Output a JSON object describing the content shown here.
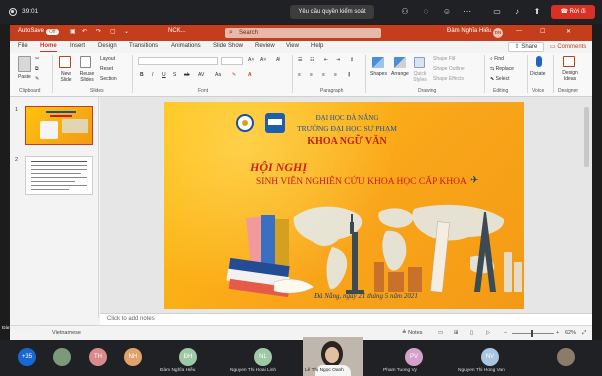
{
  "meeting": {
    "timer": "39:01",
    "request_control_label": "Yêu cầu quyền kiểm soát",
    "leave_label": "Rời đi",
    "presenter_tag": "Đàm Nghĩa Hiếu"
  },
  "ppt": {
    "autosave_label": "AutoSave",
    "autosave_state": "Off",
    "file_name": "NCK...",
    "search_placeholder": "Search",
    "user_name": "Đàm Nghĩa Hiếu",
    "user_initials": "DN",
    "tabs": [
      "File",
      "Home",
      "Insert",
      "Design",
      "Transitions",
      "Animations",
      "Slide Show",
      "Review",
      "View",
      "Help"
    ],
    "active_tab": "Home",
    "share_label": "Share",
    "comments_label": "Comments",
    "ribbon": {
      "groups": [
        "Clipboard",
        "Slides",
        "Font",
        "Paragraph",
        "Drawing",
        "Editing",
        "Voice",
        "Designer"
      ],
      "new_slide": "New Slide",
      "reuse_slides": "Reuse Slides",
      "layout": "Layout",
      "reset": "Reset",
      "section": "Section",
      "shapes": "Shapes",
      "arrange": "Arrange",
      "quick_styles": "Quick Styles",
      "shape_fill": "Shape Fill",
      "shape_outline": "Shape Outline",
      "shape_effects": "Shape Effects",
      "find": "Find",
      "replace": "Replace",
      "select": "Select",
      "dictate": "Dictate",
      "design_ideas": "Design Ideas"
    },
    "slide_numbers": [
      "1",
      "2"
    ],
    "notes_placeholder": "Click to add notes",
    "status": {
      "left": "Vietnamese",
      "notes_label": "Notes",
      "zoom": "62%"
    }
  },
  "slide": {
    "university": "ĐẠI HỌC ĐÀ NẴNG",
    "school": "TRƯỜNG ĐẠI HỌC SƯ PHẠM",
    "faculty": "KHOA NGỮ VĂN",
    "conference": "HỘI NGHỊ",
    "event": "SINH VIÊN NGHIÊN CỨU KHOA HỌC CẤP KHOA",
    "date_line": "Đà Nẵng, ngày 21 tháng 5 năm 2021"
  },
  "participants": {
    "overflow_count": "+35",
    "people": [
      {
        "initials": "TH",
        "name": "",
        "color": "#d98b8b"
      },
      {
        "initials": "NH",
        "name": "",
        "color": "#e0a46a"
      },
      {
        "initials": "ĐH",
        "name": "Đàm Nghĩa Hiếu",
        "color": "#9ec8a6"
      },
      {
        "initials": "NL",
        "name": "Nguyen Thi Hoai Linh",
        "color": "#9ec8a6"
      },
      {
        "initials": "",
        "name": "Lê Thị Ngọc Oanh",
        "color": ""
      },
      {
        "initials": "PV",
        "name": "Pham Tuong Vy",
        "color": "#d4a2c9"
      },
      {
        "initials": "NV",
        "name": "Nguyen Thi Hong Van",
        "color": "#a9c6e0"
      }
    ]
  }
}
